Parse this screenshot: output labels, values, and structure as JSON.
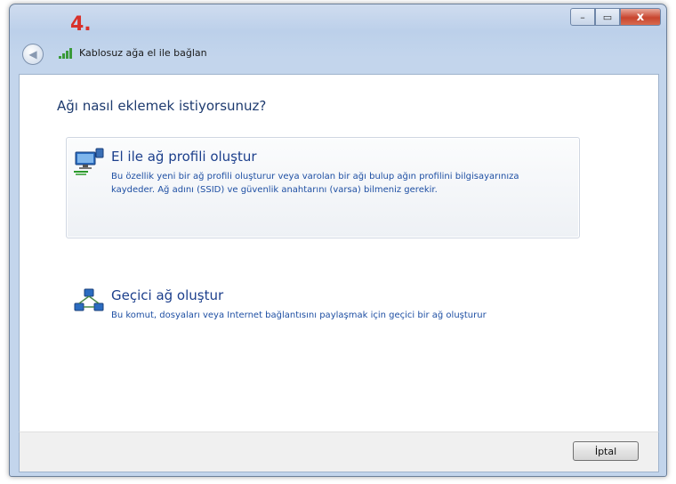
{
  "step_marker": "4.",
  "titlebar": {
    "title": "Kablosuz ağa el ile bağlan",
    "minimize_glyph": "–",
    "maximize_glyph": "▭",
    "close_glyph": "x",
    "back_glyph": "◀",
    "title_icon": "wireless-signal-icon"
  },
  "main": {
    "heading": "Ağı nasıl eklemek istiyorsunuz?",
    "options": [
      {
        "title": "El ile ağ profili oluştur",
        "description": "Bu özellik yeni bir ağ profili oluşturur veya varolan bir ağı bulup ağın profilini bilgisayarınıza kaydeder. Ağ adını (SSID) ve güvenlik anahtarını (varsa) bilmeniz gerekir.",
        "icon": "network-profile-icon"
      },
      {
        "title": "Geçici ağ oluştur",
        "description": "Bu komut, dosyaları veya Internet bağlantısını paylaşmak için geçici bir ağ oluşturur",
        "icon": "adhoc-network-icon"
      }
    ]
  },
  "footer": {
    "cancel_label": "İptal"
  },
  "colors": {
    "heading": "#1e3b6f",
    "option_title": "#1c3f8c",
    "option_desc": "#1e4fa3",
    "step_marker": "#d8312b"
  }
}
